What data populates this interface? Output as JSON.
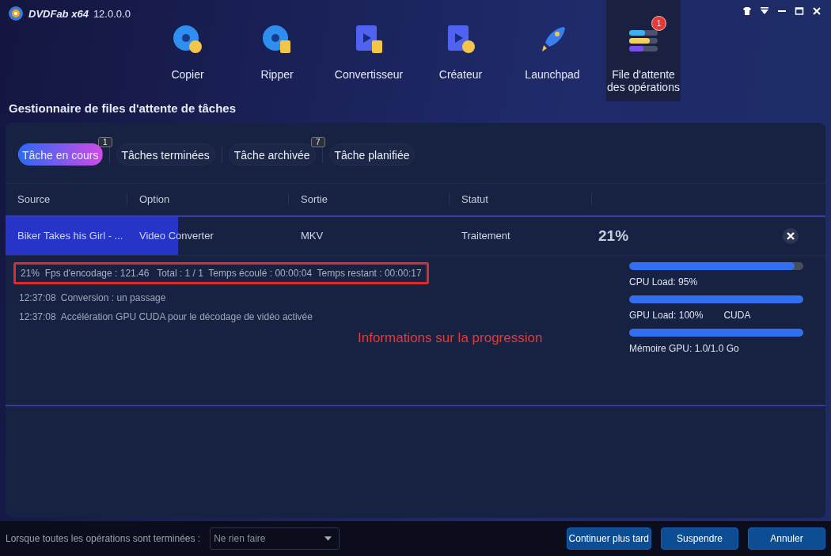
{
  "app": {
    "brand": "DVDFab x64",
    "version": "12.0.0.0"
  },
  "nav": [
    {
      "label": "Copier",
      "selected": false
    },
    {
      "label": "Ripper",
      "selected": false
    },
    {
      "label": "Convertisseur",
      "selected": false
    },
    {
      "label": "Créateur",
      "selected": false
    },
    {
      "label": "Launchpad",
      "selected": false
    },
    {
      "label": "File d'attente des opérations",
      "selected": true,
      "badge": "1"
    }
  ],
  "page_title": "Gestionnaire de files d'attente de tâches",
  "tabs": [
    {
      "label": "Tâche en cours",
      "selected": true,
      "badge": "1"
    },
    {
      "label": "Tâches terminées",
      "selected": false
    },
    {
      "label": "Tâche archivée",
      "selected": false,
      "badge": "7"
    },
    {
      "label": "Tâche planifiée",
      "selected": false
    }
  ],
  "table": {
    "columns": [
      "Source",
      "Option",
      "Sortie",
      "Statut"
    ],
    "rows": [
      {
        "source": "Biker Takes his Girl - ...",
        "option": "Video Converter",
        "output": "MKV",
        "status": "Traitement",
        "percent": "21%",
        "level": 0.21
      }
    ]
  },
  "details": {
    "progress_line": {
      "text": "21%  Fps d'encodage : 121.46   Total : 1 / 1  Temps écoulé : 00:00:04  Temps restant : 00:00:17",
      "highlighted": true
    },
    "log": [
      {
        "time": "12:37:08",
        "text": "Conversion : un passage"
      },
      {
        "time": "12:37:08",
        "text": "Accélération GPU CUDA pour le décodage de vidéo activée"
      }
    ],
    "annotation": "Informations sur la progression",
    "meters": [
      {
        "label": "CPU Load: 95%",
        "level": 0.95
      },
      {
        "label": "GPU Load: 100%",
        "extra": "CUDA",
        "level": 1
      },
      {
        "label": "Mémoire GPU: 1.0/1.0 Go",
        "level": 1
      }
    ]
  },
  "footer": {
    "label": "Lorsque toutes les opérations sont terminées :",
    "select": "Ne rien faire",
    "buttons": [
      "Continuer plus tard",
      "Suspendre",
      "Annuler"
    ]
  }
}
